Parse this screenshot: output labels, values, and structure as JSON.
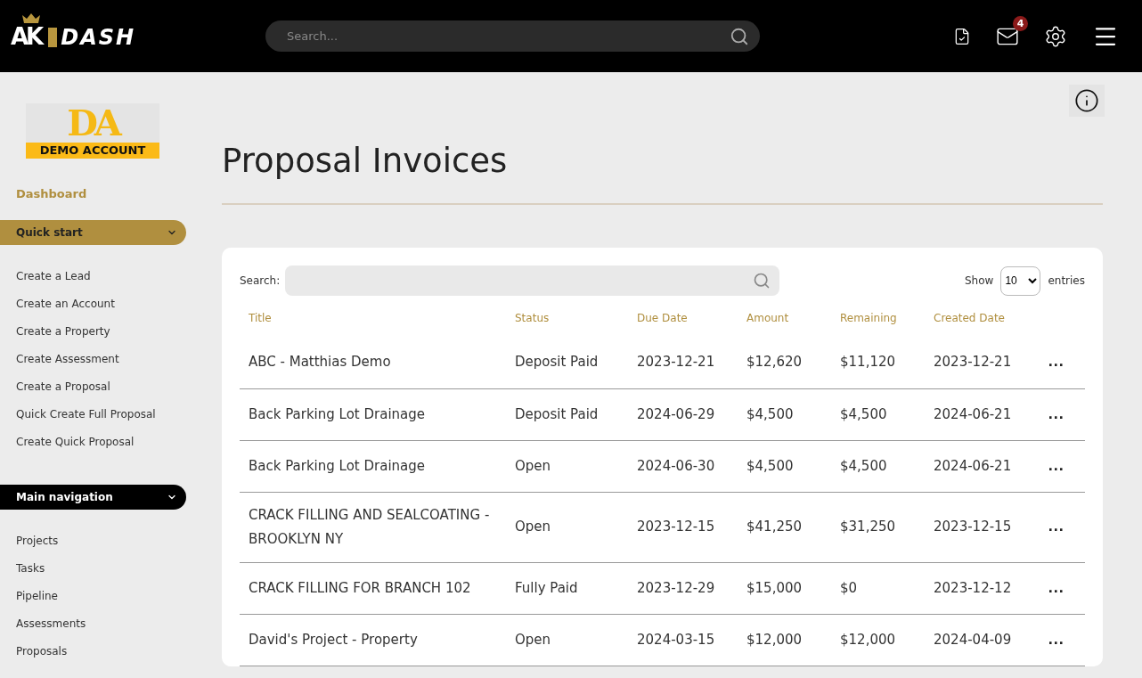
{
  "header": {
    "logo": {
      "mark": "AK",
      "word": "DASH"
    },
    "search": {
      "placeholder": "Search..."
    },
    "notifications": {
      "count": "4"
    }
  },
  "sidebar": {
    "account_logo": {
      "initials": "DA",
      "name": "DEMO ACCOUNT"
    },
    "dashboard": "Dashboard",
    "sections": [
      {
        "title": "Quick start",
        "kind": "gold",
        "expanded": true,
        "items": [
          "Create a Lead",
          "Create an Account",
          "Create a Property",
          "Create Assessment",
          "Create a Proposal",
          "Quick Create Full Proposal",
          "Create Quick Proposal"
        ]
      },
      {
        "title": "Main navigation",
        "kind": "dark",
        "expanded": true,
        "items": [
          "Projects",
          "Tasks",
          "Pipeline",
          "Assessments",
          "Proposals"
        ]
      }
    ]
  },
  "page": {
    "title": "Proposal Invoices"
  },
  "table": {
    "search_label": "Search:",
    "show_label": "Show",
    "page_size": "10",
    "entries_label": "entries",
    "columns": [
      "Title",
      "Status",
      "Due Date",
      "Amount",
      "Remaining",
      "Created Date"
    ],
    "rows": [
      {
        "title": "ABC - Matthias Demo",
        "status": "Deposit Paid",
        "due": "2023-12-21",
        "amount": "$12,620",
        "remaining": "$11,120",
        "created": "2023-12-21",
        "actions": "..."
      },
      {
        "title": "Back Parking Lot Drainage",
        "status": "Deposit Paid",
        "due": "2024-06-29",
        "amount": "$4,500",
        "remaining": "$4,500",
        "created": "2024-06-21",
        "actions": "..."
      },
      {
        "title": "Back Parking Lot Drainage",
        "status": "Open",
        "due": "2024-06-30",
        "amount": "$4,500",
        "remaining": "$4,500",
        "created": "2024-06-21",
        "actions": "..."
      },
      {
        "title": "CRACK FILLING AND SEALCOATING - BROOKLYN NY",
        "status": "Open",
        "due": "2023-12-15",
        "amount": "$41,250",
        "remaining": "$31,250",
        "created": "2023-12-15",
        "actions": "..."
      },
      {
        "title": "CRACK FILLING FOR BRANCH 102",
        "status": "Fully Paid",
        "due": "2023-12-29",
        "amount": "$15,000",
        "remaining": "$0",
        "created": "2023-12-12",
        "actions": "..."
      },
      {
        "title": "David's Project - Property",
        "status": "Open",
        "due": "2024-03-15",
        "amount": "$12,000",
        "remaining": "$12,000",
        "created": "2024-04-09",
        "actions": "..."
      }
    ]
  }
}
